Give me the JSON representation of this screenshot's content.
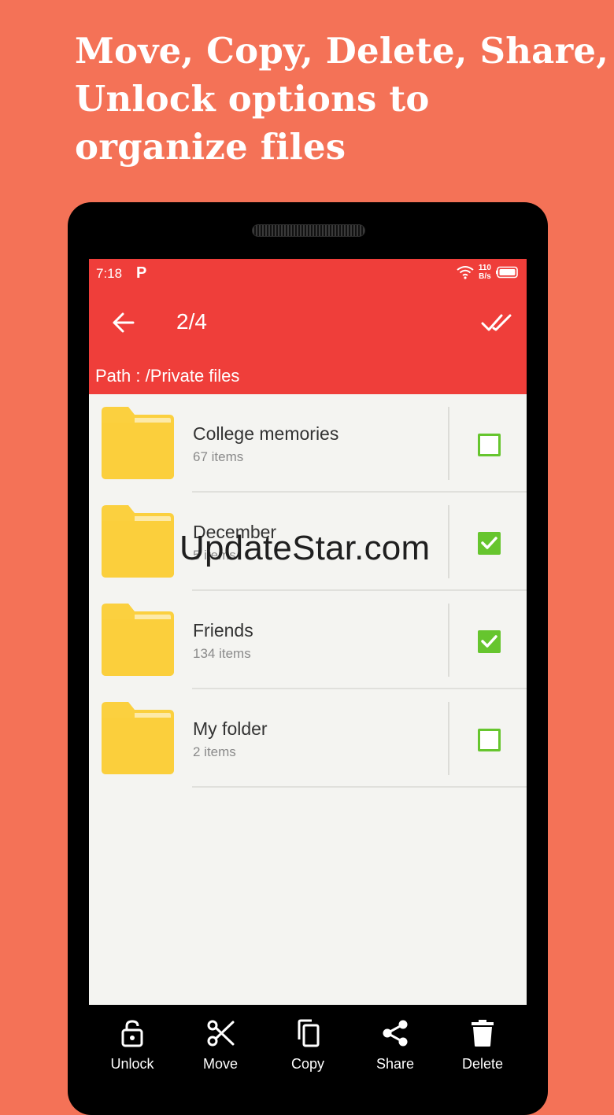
{
  "headline": {
    "line1": "Move, Copy, Delete, Share,",
    "line2": "Unlock options to",
    "line3": "organize files"
  },
  "status_bar": {
    "time": "7:18",
    "notification_icon": "P",
    "net_speed_value": "110",
    "net_speed_unit": "B/s",
    "icons": [
      "wifi-icon",
      "battery-icon"
    ]
  },
  "app_bar": {
    "counter": "2/4",
    "path": "Path : /Private files",
    "icons": [
      "back-arrow-icon",
      "double-check-icon"
    ]
  },
  "folders": [
    {
      "name": "College memories",
      "count": "67 items",
      "checked": false
    },
    {
      "name": "December",
      "count": "5 items",
      "checked": true
    },
    {
      "name": "Friends",
      "count": "134 items",
      "checked": true
    },
    {
      "name": "My folder",
      "count": "2 items",
      "checked": false
    }
  ],
  "actions": [
    {
      "label": "Unlock",
      "icon": "unlock-icon"
    },
    {
      "label": "Move",
      "icon": "scissors-icon"
    },
    {
      "label": "Copy",
      "icon": "copy-icon"
    },
    {
      "label": "Share",
      "icon": "share-icon"
    },
    {
      "label": "Delete",
      "icon": "trash-icon"
    }
  ],
  "watermark": "UpdateStar.com",
  "colors": {
    "background": "#f47257",
    "app_bar": "#ef3e3a",
    "folder": "#fbd03f",
    "checkbox": "#66c52e"
  }
}
